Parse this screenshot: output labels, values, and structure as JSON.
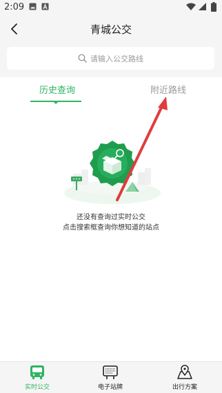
{
  "status_bar": {
    "time": "2:09",
    "icons": [
      "image-icon",
      "a-icon",
      "wifi-icon",
      "signal-icon",
      "battery-icon"
    ]
  },
  "header": {
    "title": "青城公交",
    "back_icon": "back-arrow-icon"
  },
  "search": {
    "placeholder": "请输入公交路线",
    "icon": "search-icon"
  },
  "tabs": [
    {
      "label": "历史查询",
      "active": true
    },
    {
      "label": "附近路线",
      "active": false
    }
  ],
  "empty_state": {
    "line1": "还没有查询过实时公交",
    "line2": "点击搜索框查询你想知道的站点",
    "illustration": "empty-box-badge-icon"
  },
  "bottom_nav": [
    {
      "label": "实时公交",
      "icon": "bus-icon",
      "active": true
    },
    {
      "label": "电子站牌",
      "icon": "bus-stop-board-icon",
      "active": false
    },
    {
      "label": "出行方案",
      "icon": "map-route-icon",
      "active": false
    }
  ],
  "colors": {
    "accent": "#2fb463",
    "annotation_arrow": "#e03c3c",
    "page_bg": "#f5f5f5"
  }
}
